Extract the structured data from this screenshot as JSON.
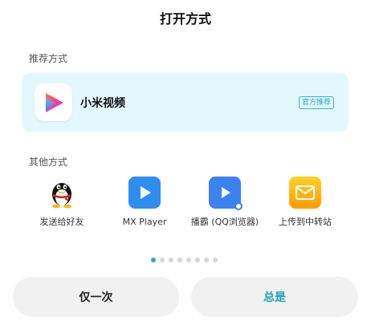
{
  "dialog": {
    "title": "打开方式"
  },
  "recommended": {
    "label": "推荐方式",
    "app": {
      "name": "小米视频",
      "badge": "官方推荐",
      "icon": "mi-video-play-icon"
    }
  },
  "others": {
    "label": "其他方式",
    "apps": [
      {
        "label": "发送给好友",
        "icon": "qq-penguin-icon"
      },
      {
        "label": "MX Player",
        "icon": "mx-player-play-icon"
      },
      {
        "label": "播霸 (QQ浏览器)",
        "icon": "qq-browser-player-icon"
      },
      {
        "label": "上传到中转站",
        "icon": "envelope-icon"
      }
    ]
  },
  "pager": {
    "total": 8,
    "active": 0
  },
  "buttons": {
    "once": "仅一次",
    "always": "总是"
  },
  "colors": {
    "accent": "#22a3c2",
    "card_bg": "#e3f8fd",
    "button_bg": "#f1f1f1"
  }
}
